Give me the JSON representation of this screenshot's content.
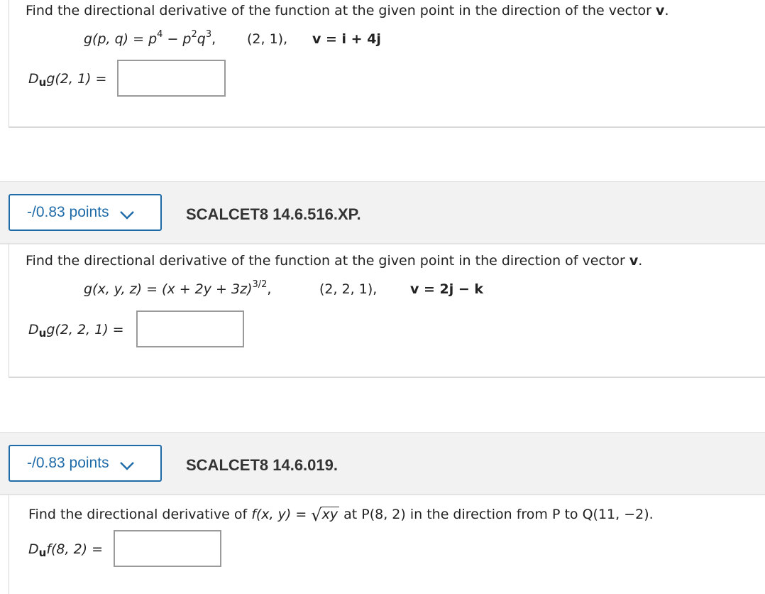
{
  "q1": {
    "prompt_start": "Find the directional derivative of the function at the given point in the direction of the vector ",
    "prompt_v": "v",
    "prompt_end": ".",
    "func": "g(p, q) = p",
    "func_exp1": "4",
    "func_mid": " − p",
    "func_exp2": "2",
    "func_q": "q",
    "func_exp3": "3",
    "func_end": ",",
    "point": "(2, 1),",
    "vector": "v = i + 4j",
    "answer_label_d": "D",
    "answer_label_u": "u",
    "answer_label_rest": "g(2, 1) =",
    "answer_value": ""
  },
  "q2": {
    "points": "-/0.83 points",
    "id": "SCALCET8 14.6.516.XP.",
    "prompt_start": "Find the directional derivative of the function at the given point in the direction of vector ",
    "prompt_v": "v",
    "prompt_end": ".",
    "func": "g(x, y, z) = (x + 2y + 3z)",
    "func_exp": "3/2",
    "func_end": ",",
    "point": "(2, 2, 1),",
    "vector": "v = 2j − k",
    "answer_label_d": "D",
    "answer_label_u": "u",
    "answer_label_rest": "g(2, 2, 1) =",
    "answer_value": ""
  },
  "q3": {
    "points": "-/0.83 points",
    "id": "SCALCET8 14.6.019.",
    "prompt_start": "Find the directional derivative of ",
    "func": "f(x, y) =",
    "radical": "√",
    "radicand": "xy",
    "prompt_mid": " at P(8, 2) in the direction from P to Q(11, −2).",
    "answer_label_d": "D",
    "answer_label_u": "u",
    "answer_label_rest": "f(8, 2) =",
    "answer_value": ""
  },
  "colors": {
    "accent": "#1f6ba8",
    "header_bg": "#f2f2f2",
    "border": "#d7d7d7"
  },
  "icons": {
    "points_dropdown": "chevron-down-icon"
  }
}
